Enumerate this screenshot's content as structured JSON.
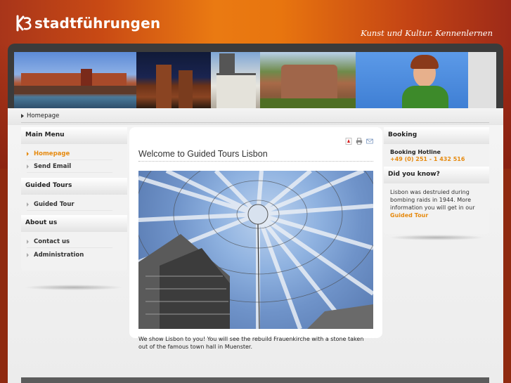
{
  "header": {
    "logo_text": "stadtführungen",
    "tagline": "Kunst und Kultur. Kennenlernen"
  },
  "breadcrumb": {
    "label": "Homepage"
  },
  "left": {
    "main_menu_title": "Main Menu",
    "main_menu": [
      {
        "label": "Homepage",
        "active": true
      },
      {
        "label": "Send Email",
        "active": false
      }
    ],
    "tours_title": "Guided Tours",
    "tours": [
      {
        "label": "Guided Tour"
      }
    ],
    "about_title": "About us",
    "about": [
      {
        "label": "Contact us"
      },
      {
        "label": "Administration"
      }
    ]
  },
  "main": {
    "title": "Welcome to Guided Tours Lisbon",
    "icons": [
      "pdf-icon",
      "print-icon",
      "email-icon"
    ],
    "body": "We show Lisbon to you! You will see the rebuild Frauenkirche with a stone taken out of the famous town hall in Muenster."
  },
  "right": {
    "booking_title": "Booking",
    "hotline_label": "Booking Hotline",
    "hotline_number": "+49 (0) 251 - 1 432 516",
    "know_title": "Did you know?",
    "know_text": "Lisbon was destruied during bombing raids in 1944. More information you will get in our",
    "know_link": "Guided Tour"
  },
  "colors": {
    "accent": "#e68a0f",
    "header_orange": "#ea7a12",
    "header_red": "#9d2a18"
  }
}
